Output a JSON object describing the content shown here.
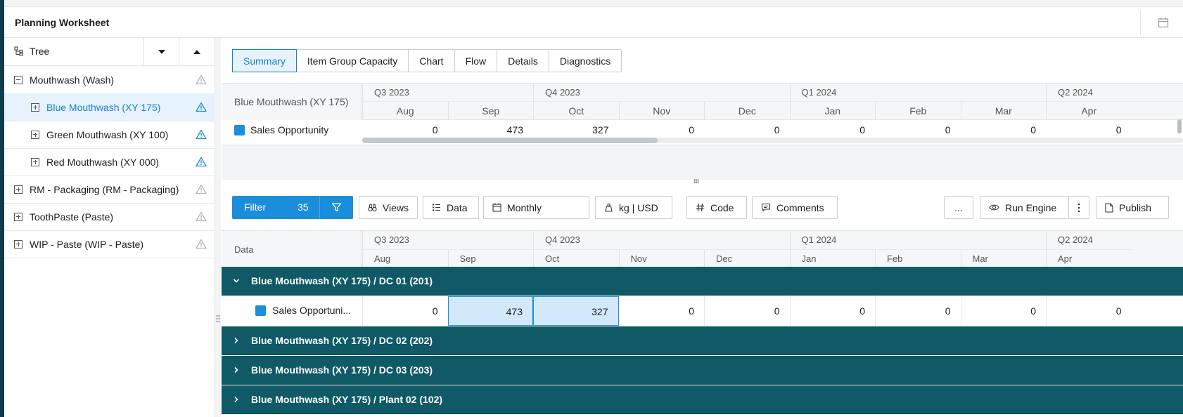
{
  "header": {
    "title": "Planning Worksheet"
  },
  "tree": {
    "head_label": "Tree",
    "items": [
      {
        "label": "Mouthwash (Wash)",
        "expanded": true,
        "level": 0,
        "warn_color": "#b0b4b9"
      },
      {
        "label": "Blue Mouthwash (XY 175)",
        "expanded": false,
        "level": 1,
        "selected": true,
        "warn_color": "#1a8ddb"
      },
      {
        "label": "Green Mouthwash (XY 100)",
        "expanded": false,
        "level": 1,
        "warn_color": "#1a8ddb"
      },
      {
        "label": "Red Mouthwash (XY 000)",
        "expanded": false,
        "level": 1,
        "warn_color": "#1a8ddb"
      },
      {
        "label": "RM - Packaging (RM - Packaging)",
        "expanded": false,
        "level": 0,
        "warn_color": "#b0b4b9"
      },
      {
        "label": "ToothPaste (Paste)",
        "expanded": false,
        "level": 0,
        "warn_color": "#b0b4b9"
      },
      {
        "label": "WIP - Paste (WIP - Paste)",
        "expanded": false,
        "level": 0,
        "warn_color": "#b0b4b9"
      }
    ]
  },
  "tabs": [
    "Summary",
    "Item Group Capacity",
    "Chart",
    "Flow",
    "Details",
    "Diagnostics"
  ],
  "summary_grid": {
    "row_header": "Blue Mouthwash (XY 175)",
    "quarters": [
      "Q3 2023",
      "Q4 2023",
      "Q1 2024",
      "Q2 2024"
    ],
    "months": [
      "Aug",
      "Sep",
      "Oct",
      "Nov",
      "Dec",
      "Jan",
      "Feb",
      "Mar",
      "Apr"
    ],
    "row_label": "Sales Opportunity",
    "values": [
      "0",
      "473",
      "327",
      "0",
      "0",
      "0",
      "0",
      "0",
      "0"
    ]
  },
  "toolbar": {
    "filter_label": "Filter",
    "filter_count": "35",
    "views": "Views",
    "data": "Data",
    "period": "Monthly",
    "units": "kg | USD",
    "code": "Code",
    "comments": "Comments",
    "more": "...",
    "run_engine": "Run Engine",
    "publish": "Publish"
  },
  "detail_grid": {
    "data_header": "Data",
    "quarters": [
      "Q3 2023",
      "Q4 2023",
      "Q1 2024",
      "Q2 2024"
    ],
    "months": [
      "Aug",
      "Sep",
      "Oct",
      "Nov",
      "Dec",
      "Jan",
      "Feb",
      "Mar",
      "Apr"
    ],
    "groups": [
      {
        "label": "Blue Mouthwash (XY 175) / DC 01 (201)",
        "expanded": true
      },
      {
        "label": "Blue Mouthwash (XY 175) / DC 02 (202)",
        "expanded": false
      },
      {
        "label": "Blue Mouthwash (XY 175) / DC 03 (203)",
        "expanded": false
      },
      {
        "label": "Blue Mouthwash (XY 175) / Plant 02 (102)",
        "expanded": false
      }
    ],
    "row_label": "Sales Opportuni...",
    "values": [
      "0",
      "473",
      "327",
      "0",
      "0",
      "0",
      "0",
      "0",
      "0"
    ]
  },
  "colors": {
    "accent": "#1a8ddb",
    "group_bg": "#0f5a66",
    "sidebar": "#0f3c4a"
  }
}
